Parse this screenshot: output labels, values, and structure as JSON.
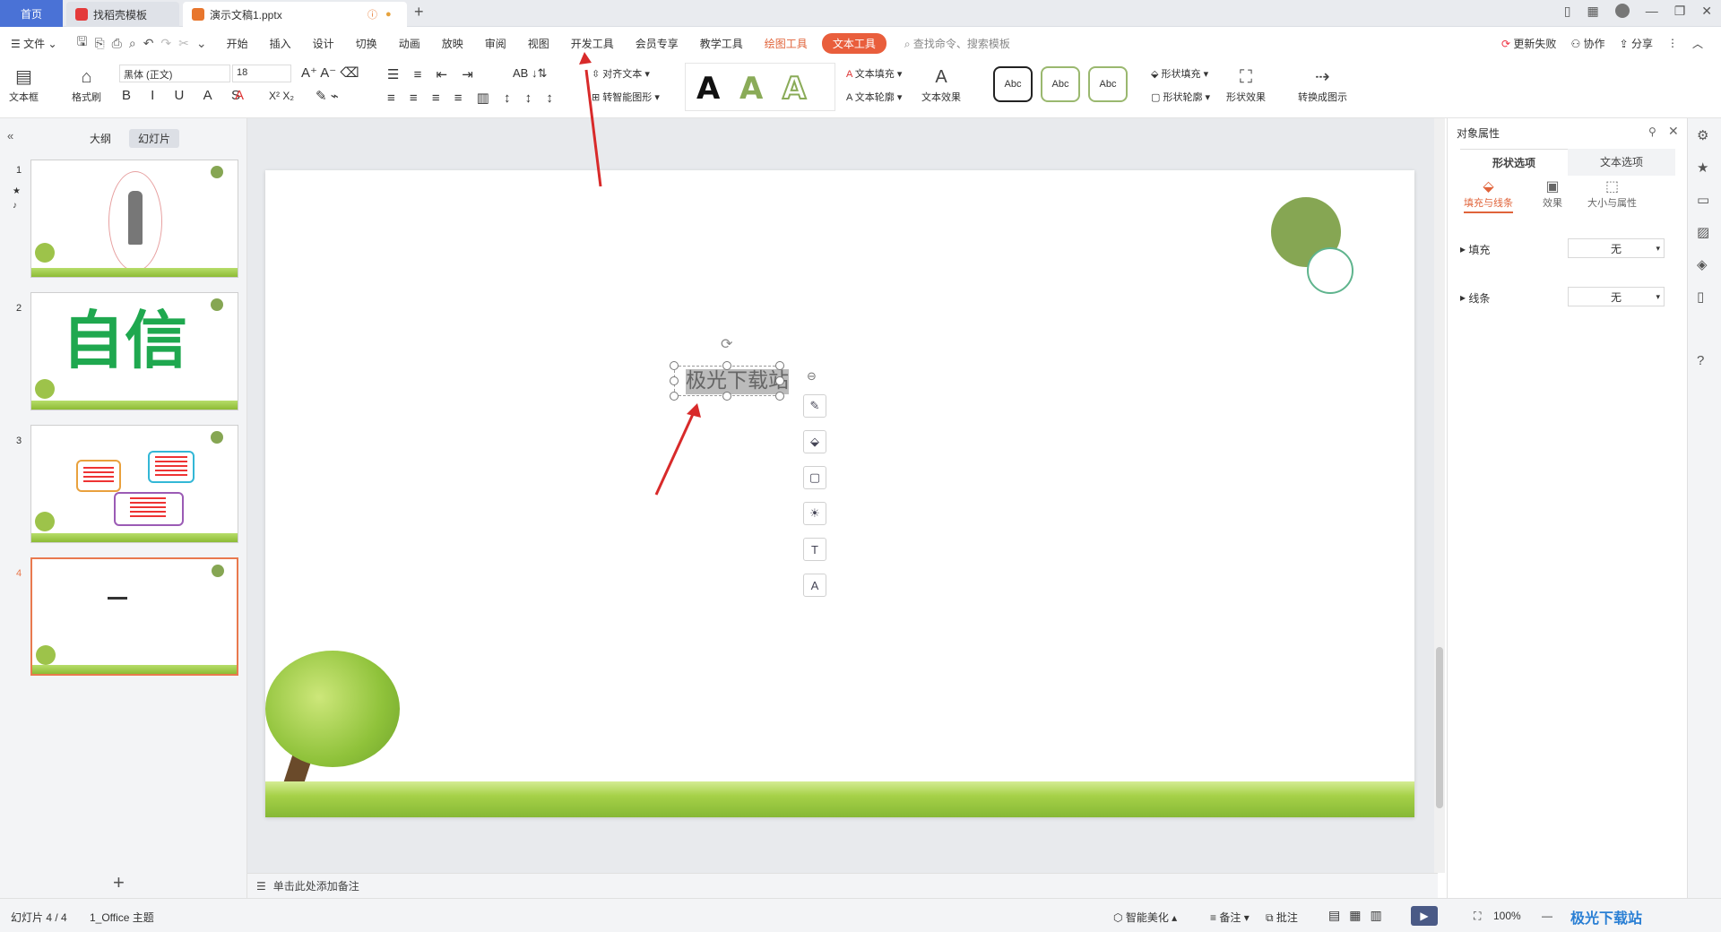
{
  "tabs": {
    "home": "首页",
    "docer": "找稻壳模板",
    "doc": "演示文稿1.pptx"
  },
  "menu": {
    "file": "文件",
    "items": [
      "开始",
      "插入",
      "设计",
      "切换",
      "动画",
      "放映",
      "审阅",
      "视图",
      "开发工具",
      "会员专享",
      "教学工具"
    ],
    "context_draw": "绘图工具",
    "context_text": "文本工具",
    "search": "查找命令、搜索模板",
    "update_fail": "更新失败",
    "collab": "协作",
    "share": "分享"
  },
  "ribbon": {
    "textbox": "文本框",
    "format_painter": "格式刷",
    "font_name": "黑体 (正文)",
    "font_size": "18",
    "align_text": "对齐文本",
    "smart_shape": "转智能图形",
    "text_fill": "文本填充",
    "text_outline": "文本轮廓",
    "text_effect": "文本效果",
    "style_sample": "Abc",
    "shape_fill": "形状填充",
    "shape_outline": "形状轮廓",
    "shape_effect": "形状效果",
    "convert_diagram": "转换成图示",
    "glyph_A": "A"
  },
  "left_panel": {
    "tab_outline": "大纲",
    "tab_slides": "幻灯片",
    "slide_numbers": [
      "1",
      "2",
      "3",
      "4"
    ],
    "slide2_text": "自信"
  },
  "slide": {
    "textbox_text": "极光下载站"
  },
  "notes": {
    "placeholder": "单击此处添加备注"
  },
  "properties": {
    "title": "对象属性",
    "tab_shape": "形状选项",
    "tab_text": "文本选项",
    "sub_fill_line": "填充与线条",
    "sub_effect": "效果",
    "sub_size": "大小与属性",
    "fill_label": "填充",
    "fill_value": "无",
    "line_label": "线条",
    "line_value": "无"
  },
  "status": {
    "slide_counter": "幻灯片 4 / 4",
    "theme": "1_Office 主题",
    "smart_beautify": "智能美化",
    "notes": "备注",
    "comments": "批注",
    "zoom": "100%"
  },
  "watermark": "极光下载站",
  "colors": {
    "accent_orange": "#e95e3c",
    "tab_home_blue": "#4a72d6",
    "circle_green": "#86a653",
    "ring_green": "#5fb48d",
    "slide2_green": "#1fa84f"
  }
}
